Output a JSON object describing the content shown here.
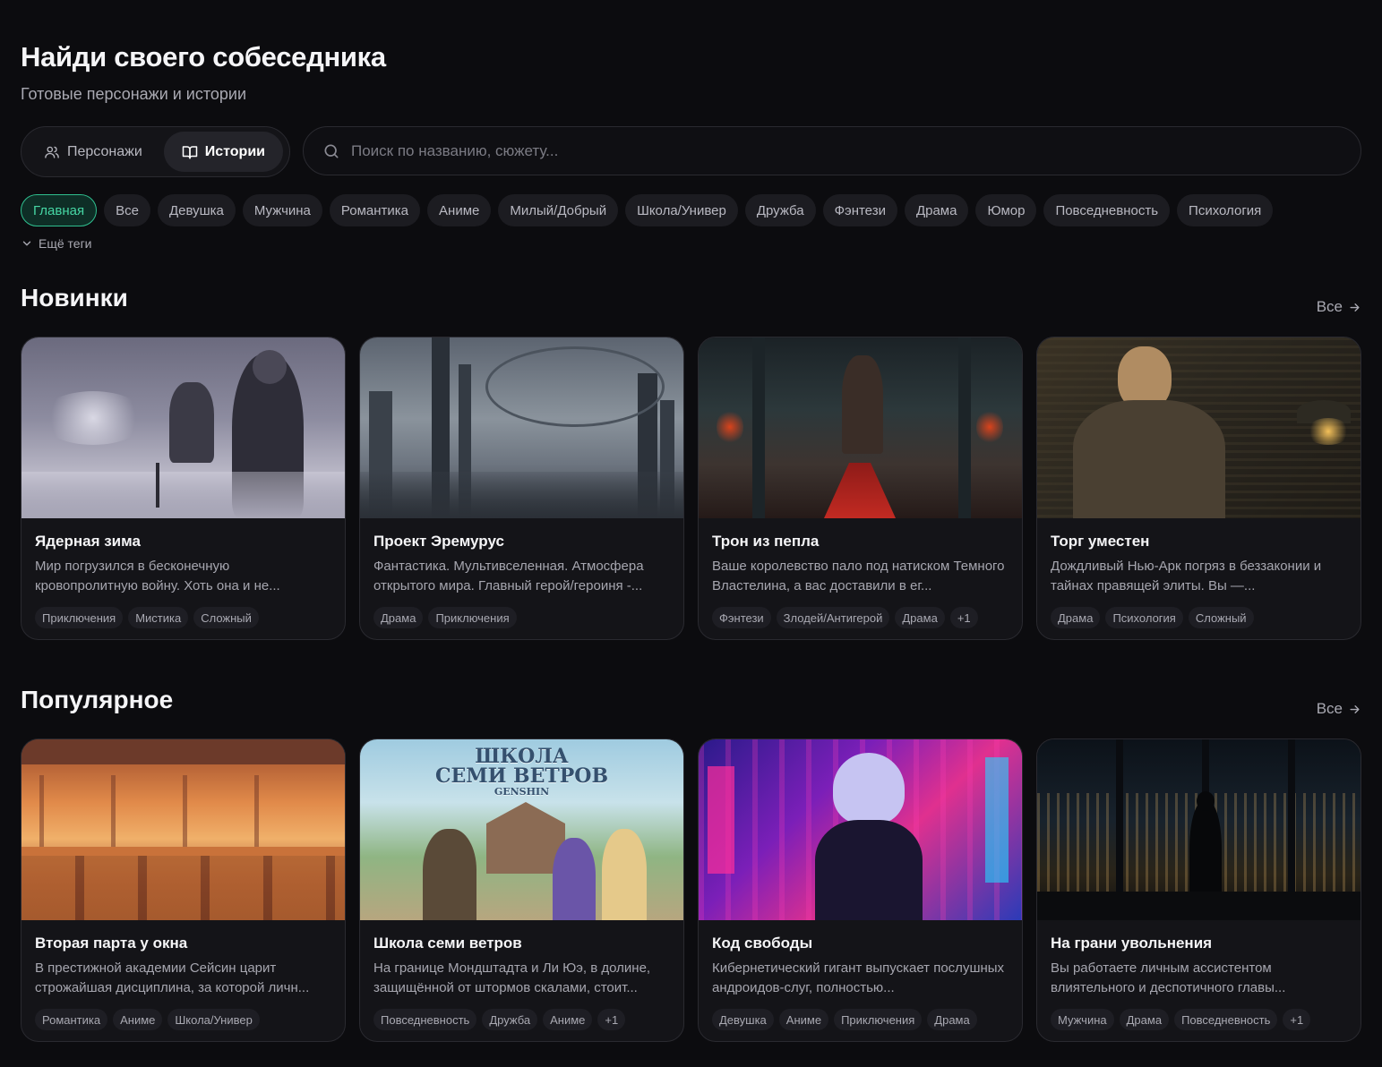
{
  "header": {
    "title": "Найди своего собеседника",
    "subtitle": "Готовые персонажи и истории"
  },
  "mode_switch": {
    "items": [
      {
        "label": "Персонажи",
        "icon": "users-icon",
        "active": false
      },
      {
        "label": "Истории",
        "icon": "book-open-icon",
        "active": true
      }
    ]
  },
  "search": {
    "placeholder": "Поиск по названию, сюжету..."
  },
  "tags": [
    {
      "label": "Главная",
      "active": true
    },
    {
      "label": "Все",
      "active": false
    },
    {
      "label": "Девушка",
      "active": false
    },
    {
      "label": "Мужчина",
      "active": false
    },
    {
      "label": "Романтика",
      "active": false
    },
    {
      "label": "Аниме",
      "active": false
    },
    {
      "label": "Милый/Добрый",
      "active": false
    },
    {
      "label": "Школа/Универ",
      "active": false
    },
    {
      "label": "Дружба",
      "active": false
    },
    {
      "label": "Фэнтези",
      "active": false
    },
    {
      "label": "Драма",
      "active": false
    },
    {
      "label": "Юмор",
      "active": false
    },
    {
      "label": "Повседневность",
      "active": false
    },
    {
      "label": "Психология",
      "active": false
    }
  ],
  "more_tags_label": "Ещё теги",
  "accent_color": "#2fbf8f",
  "sections": [
    {
      "title": "Новинки",
      "see_all": "Все",
      "cards": [
        {
          "title": "Ядерная зима",
          "description": "Мир погрузился в бесконечную кровопролитную войну. Хоть она и не...",
          "tags": [
            "Приключения",
            "Мистика",
            "Сложный"
          ],
          "image": "snowy-soldiers-image"
        },
        {
          "title": "Проект Эремурус",
          "description": "Фантастика. Мультивселенная. Атмосфера открытого мира. Главный герой/героиня -...",
          "tags": [
            "Драма",
            "Приключения"
          ],
          "image": "scifi-city-image"
        },
        {
          "title": "Трон из пепла",
          "description": "Ваше королевство пало под натиском Темного Властелина, а вас доставили в ег...",
          "tags": [
            "Фэнтези",
            "Злодей/Антигерой",
            "Драма",
            "+1"
          ],
          "image": "throne-hall-image"
        },
        {
          "title": "Торг уместен",
          "description": "Дождливый Нью-Арк погряз в беззаконии и тайнах правящей элиты. Вы —...",
          "tags": [
            "Драма",
            "Психология",
            "Сложный"
          ],
          "image": "noir-detective-image"
        }
      ]
    },
    {
      "title": "Популярное",
      "see_all": "Все",
      "cards": [
        {
          "title": "Вторая парта у окна",
          "description": "В престижной академии Сейсин царит строжайшая дисциплина, за которой личн...",
          "tags": [
            "Романтика",
            "Аниме",
            "Школа/Универ"
          ],
          "image": "sunset-classroom-image"
        },
        {
          "title": "Школа семи ветров",
          "description": "На границе Мондштадта и Ли Юэ, в долине, защищённой от штормов скалами, стоит...",
          "tags": [
            "Повседневность",
            "Дружба",
            "Аниме",
            "+1"
          ],
          "image": "anime-school-image",
          "image_text": [
            "ШКОЛА",
            "СЕМИ ВЕТРОВ",
            "GENSHIN"
          ]
        },
        {
          "title": "Код свободы",
          "description": "Кибернетический гигант выпускает послушных андроидов-слуг, полностью...",
          "tags": [
            "Девушка",
            "Аниме",
            "Приключения",
            "Драма"
          ],
          "image": "cyberpunk-girl-image"
        },
        {
          "title": "На грани увольнения",
          "description": "Вы работаете личным ассистентом влиятельного и деспотичного главы...",
          "tags": [
            "Мужчина",
            "Драма",
            "Повседневность",
            "+1"
          ],
          "image": "night-office-image"
        }
      ]
    }
  ]
}
